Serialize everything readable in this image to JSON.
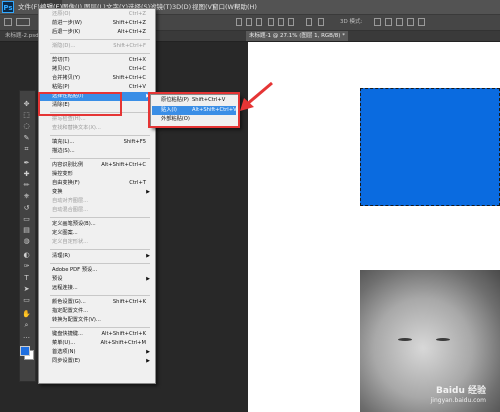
{
  "app": {
    "logo": "Ps"
  },
  "menubar": {
    "items": [
      "文件(F)",
      "编辑(E)",
      "图像(I)",
      "图层(L)",
      "文字(Y)",
      "选择(S)",
      "滤镜(T)",
      "3D(D)",
      "视图(V)",
      "窗口(W)",
      "帮助(H)"
    ],
    "active_index": 1
  },
  "optionsbar": {
    "mode_label": "3D 模式:"
  },
  "tabs": [
    {
      "label": "未标题-2.psd @ 100% (图层 4, RGB/8) *",
      "active": false
    },
    {
      "label": "未标题-1 @ 27.1% (图层 1, RGB/8) *",
      "active": true
    }
  ],
  "edit_menu": {
    "items": [
      {
        "label": "还原(O)",
        "shortcut": "Ctrl+Z",
        "disabled": true
      },
      {
        "label": "前进一步(W)",
        "shortcut": "Shift+Ctrl+Z",
        "disabled": false
      },
      {
        "label": "后退一步(K)",
        "shortcut": "Alt+Ctrl+Z",
        "disabled": false
      },
      {
        "sep": true
      },
      {
        "label": "渐隐(D)...",
        "shortcut": "Shift+Ctrl+F",
        "disabled": true
      },
      {
        "sep": true
      },
      {
        "label": "剪切(T)",
        "shortcut": "Ctrl+X",
        "disabled": false
      },
      {
        "label": "拷贝(C)",
        "shortcut": "Ctrl+C",
        "disabled": false
      },
      {
        "label": "合并拷贝(Y)",
        "shortcut": "Shift+Ctrl+C",
        "disabled": false
      },
      {
        "label": "粘贴(P)",
        "shortcut": "Ctrl+V",
        "disabled": false
      },
      {
        "label": "选择性粘贴(I)",
        "shortcut": "",
        "submenu": true,
        "highlighted": true
      },
      {
        "label": "清除(E)",
        "shortcut": "",
        "disabled": false
      },
      {
        "sep": true
      },
      {
        "label": "拼写检查(H)...",
        "shortcut": "",
        "disabled": true
      },
      {
        "label": "查找和替换文本(X)...",
        "shortcut": "",
        "disabled": true
      },
      {
        "sep": true
      },
      {
        "label": "填充(L)...",
        "shortcut": "Shift+F5",
        "disabled": false
      },
      {
        "label": "描边(S)...",
        "shortcut": "",
        "disabled": false
      },
      {
        "sep": true
      },
      {
        "label": "内容识别比例",
        "shortcut": "Alt+Shift+Ctrl+C",
        "disabled": false
      },
      {
        "label": "操控变形",
        "shortcut": "",
        "disabled": false
      },
      {
        "label": "自由变换(F)",
        "shortcut": "Ctrl+T",
        "disabled": false
      },
      {
        "label": "变换",
        "shortcut": "",
        "submenu": true
      },
      {
        "label": "自动对齐图层...",
        "shortcut": "",
        "disabled": true
      },
      {
        "label": "自动混合图层...",
        "shortcut": "",
        "disabled": true
      },
      {
        "sep": true
      },
      {
        "label": "定义画笔预设(B)...",
        "shortcut": "",
        "disabled": false
      },
      {
        "label": "定义图案...",
        "shortcut": "",
        "disabled": false
      },
      {
        "label": "定义自定形状...",
        "shortcut": "",
        "disabled": true
      },
      {
        "sep": true
      },
      {
        "label": "清理(R)",
        "shortcut": "",
        "submenu": true
      },
      {
        "sep": true
      },
      {
        "label": "Adobe PDF 预设...",
        "shortcut": "",
        "disabled": false
      },
      {
        "label": "预设",
        "shortcut": "",
        "submenu": true
      },
      {
        "label": "远程连接...",
        "shortcut": "",
        "disabled": false
      },
      {
        "sep": true
      },
      {
        "label": "颜色设置(G)...",
        "shortcut": "Shift+Ctrl+K",
        "disabled": false
      },
      {
        "label": "指定配置文件...",
        "shortcut": "",
        "disabled": false
      },
      {
        "label": "转换为配置文件(V)...",
        "shortcut": "",
        "disabled": false
      },
      {
        "sep": true
      },
      {
        "label": "键盘快捷键...",
        "shortcut": "Alt+Shift+Ctrl+K",
        "disabled": false
      },
      {
        "label": "菜单(U)...",
        "shortcut": "Alt+Shift+Ctrl+M",
        "disabled": false
      },
      {
        "label": "首选项(N)",
        "shortcut": "",
        "submenu": true
      },
      {
        "label": "同步设置(E)",
        "shortcut": "",
        "submenu": true
      }
    ]
  },
  "paste_special_submenu": {
    "items": [
      {
        "label": "原位粘贴(P)",
        "shortcut": "Shift+Ctrl+V",
        "highlighted": false
      },
      {
        "label": "贴入(I)",
        "shortcut": "Alt+Shift+Ctrl+V",
        "highlighted": true
      },
      {
        "label": "外部粘贴(O)",
        "shortcut": "",
        "highlighted": false
      }
    ]
  },
  "watermark": {
    "main": "Baidu 经验",
    "sub": "jingyan.baidu.com"
  },
  "colors": {
    "foreground": "#1f6fe0",
    "background": "#ffffff",
    "highlight": "#3a8ee6",
    "annotation": "#e53535"
  }
}
